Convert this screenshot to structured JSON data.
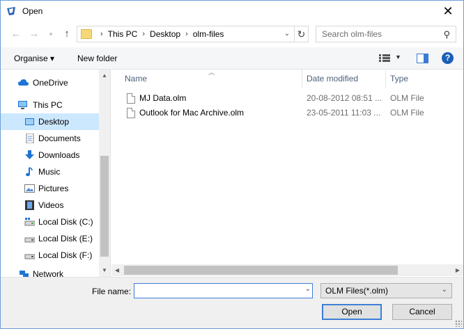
{
  "window": {
    "title": "Open"
  },
  "address": {
    "crumbs": [
      "This PC",
      "Desktop",
      "olm-files"
    ]
  },
  "search": {
    "placeholder": "Search olm-files"
  },
  "toolbar": {
    "organise_label": "Organise ▾",
    "new_folder_label": "New folder",
    "help_label": "?"
  },
  "nav": {
    "items": [
      {
        "label": "OneDrive",
        "icon": "cloud-icon"
      },
      {
        "label": "This PC",
        "icon": "computer-icon"
      },
      {
        "label": "Desktop",
        "icon": "desktop-icon",
        "selected": true
      },
      {
        "label": "Documents",
        "icon": "documents-icon"
      },
      {
        "label": "Downloads",
        "icon": "download-arrow-icon"
      },
      {
        "label": "Music",
        "icon": "music-note-icon"
      },
      {
        "label": "Pictures",
        "icon": "pictures-icon"
      },
      {
        "label": "Videos",
        "icon": "film-icon"
      },
      {
        "label": "Local Disk (C:)",
        "icon": "drive-icon"
      },
      {
        "label": "Local Disk (E:)",
        "icon": "drive-icon"
      },
      {
        "label": "Local Disk (F:)",
        "icon": "drive-icon"
      },
      {
        "label": "Network",
        "icon": "network-icon"
      }
    ]
  },
  "files": {
    "columns": [
      "Name",
      "Date modified",
      "Type"
    ],
    "rows": [
      {
        "name": "MJ Data.olm",
        "date": "20-08-2012 08:51 ...",
        "type": "OLM File"
      },
      {
        "name": "Outlook for Mac Archive.olm",
        "date": "23-05-2011 11:03 ...",
        "type": "OLM File"
      }
    ]
  },
  "footer": {
    "file_name_label": "File name:",
    "file_name_value": "",
    "file_type_value": "OLM Files(*.olm)",
    "open_label": "Open",
    "cancel_label": "Cancel"
  },
  "colors": {
    "accent": "#3c7fd6",
    "selected_bg": "#cce8ff",
    "help_blue": "#1c5fb8"
  }
}
